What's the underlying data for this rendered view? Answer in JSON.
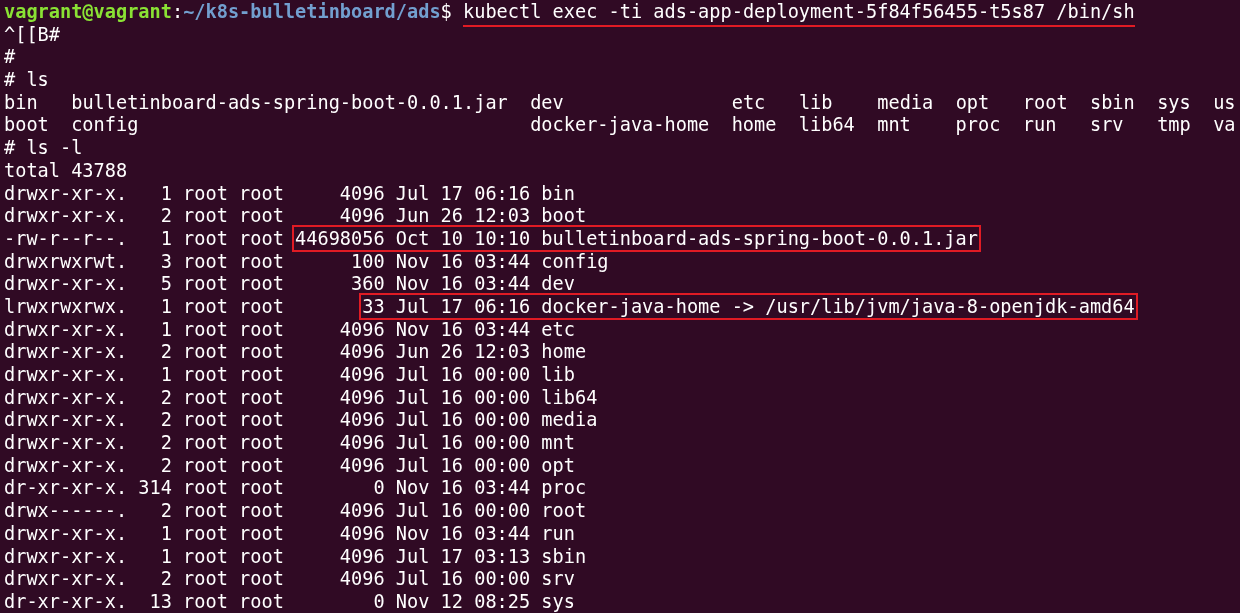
{
  "terminal": {
    "lines": [
      {
        "kind": "prompt",
        "user_host": "vagrant@vagrant",
        "separator": ":",
        "path": "~/k8s-bulletinboard/ads",
        "symbol": "$",
        "command": "kubectl exec -ti ads-app-deployment-5f84f56455-t5s87 /bin/sh",
        "underlined": true
      },
      {
        "kind": "text",
        "text": "^[[B#"
      },
      {
        "kind": "text",
        "text": "#"
      },
      {
        "kind": "text",
        "text": "# ls"
      },
      {
        "kind": "columns",
        "columns": [
          [
            "bin",
            "boot"
          ],
          [
            "bulletinboard-ads-spring-boot-0.0.1.jar",
            "config"
          ],
          [
            "dev",
            "docker-java-home"
          ],
          [
            "etc",
            "home"
          ],
          [
            "lib",
            "lib64"
          ],
          [
            "media",
            "mnt"
          ],
          [
            "opt",
            "proc"
          ],
          [
            "root",
            "run"
          ],
          [
            "sbin",
            "srv"
          ],
          [
            "sys",
            "tmp"
          ],
          [
            "us",
            "va"
          ]
        ]
      },
      {
        "kind": "text",
        "text": "# ls -l"
      },
      {
        "kind": "text",
        "text": "total 43788"
      },
      {
        "kind": "listing",
        "rows": [
          {
            "permissions": "drwxr-xr-x.",
            "links": "1",
            "owner": "root",
            "group": "root",
            "size": "4096",
            "date": "Jul 17 06:16",
            "name": "bin",
            "highlighted": false
          },
          {
            "permissions": "drwxr-xr-x.",
            "links": "2",
            "owner": "root",
            "group": "root",
            "size": "4096",
            "date": "Jun 26 12:03",
            "name": "boot",
            "highlighted": false
          },
          {
            "permissions": "-rw-r--r--.",
            "links": "1",
            "owner": "root",
            "group": "root",
            "size": "44698056",
            "date": "Oct 10 10:10",
            "name": "bulletinboard-ads-spring-boot-0.0.1.jar",
            "highlighted": true
          },
          {
            "permissions": "drwxrwxrwt.",
            "links": "3",
            "owner": "root",
            "group": "root",
            "size": "100",
            "date": "Nov 16 03:44",
            "name": "config",
            "highlighted": false
          },
          {
            "permissions": "drwxr-xr-x.",
            "links": "5",
            "owner": "root",
            "group": "root",
            "size": "360",
            "date": "Nov 16 03:44",
            "name": "dev",
            "highlighted": false
          },
          {
            "permissions": "lrwxrwxrwx.",
            "links": "1",
            "owner": "root",
            "group": "root",
            "size": "33",
            "date": "Jul 17 06:16",
            "name": "docker-java-home -> /usr/lib/jvm/java-8-openjdk-amd64",
            "highlighted": true
          },
          {
            "permissions": "drwxr-xr-x.",
            "links": "1",
            "owner": "root",
            "group": "root",
            "size": "4096",
            "date": "Nov 16 03:44",
            "name": "etc",
            "highlighted": false
          },
          {
            "permissions": "drwxr-xr-x.",
            "links": "2",
            "owner": "root",
            "group": "root",
            "size": "4096",
            "date": "Jun 26 12:03",
            "name": "home",
            "highlighted": false
          },
          {
            "permissions": "drwxr-xr-x.",
            "links": "1",
            "owner": "root",
            "group": "root",
            "size": "4096",
            "date": "Jul 16 00:00",
            "name": "lib",
            "highlighted": false
          },
          {
            "permissions": "drwxr-xr-x.",
            "links": "2",
            "owner": "root",
            "group": "root",
            "size": "4096",
            "date": "Jul 16 00:00",
            "name": "lib64",
            "highlighted": false
          },
          {
            "permissions": "drwxr-xr-x.",
            "links": "2",
            "owner": "root",
            "group": "root",
            "size": "4096",
            "date": "Jul 16 00:00",
            "name": "media",
            "highlighted": false
          },
          {
            "permissions": "drwxr-xr-x.",
            "links": "2",
            "owner": "root",
            "group": "root",
            "size": "4096",
            "date": "Jul 16 00:00",
            "name": "mnt",
            "highlighted": false
          },
          {
            "permissions": "drwxr-xr-x.",
            "links": "2",
            "owner": "root",
            "group": "root",
            "size": "4096",
            "date": "Jul 16 00:00",
            "name": "opt",
            "highlighted": false
          },
          {
            "permissions": "dr-xr-xr-x.",
            "links": "314",
            "owner": "root",
            "group": "root",
            "size": "0",
            "date": "Nov 16 03:44",
            "name": "proc",
            "highlighted": false
          },
          {
            "permissions": "drwx------.",
            "links": "2",
            "owner": "root",
            "group": "root",
            "size": "4096",
            "date": "Jul 16 00:00",
            "name": "root",
            "highlighted": false
          },
          {
            "permissions": "drwxr-xr-x.",
            "links": "1",
            "owner": "root",
            "group": "root",
            "size": "4096",
            "date": "Nov 16 03:44",
            "name": "run",
            "highlighted": false
          },
          {
            "permissions": "drwxr-xr-x.",
            "links": "1",
            "owner": "root",
            "group": "root",
            "size": "4096",
            "date": "Jul 17 03:13",
            "name": "sbin",
            "highlighted": false
          },
          {
            "permissions": "drwxr-xr-x.",
            "links": "2",
            "owner": "root",
            "group": "root",
            "size": "4096",
            "date": "Jul 16 00:00",
            "name": "srv",
            "highlighted": false
          },
          {
            "permissions": "dr-xr-xr-x.",
            "links": "13",
            "owner": "root",
            "group": "root",
            "size": "0",
            "date": "Nov 12 08:25",
            "name": "sys",
            "highlighted": false
          }
        ]
      }
    ]
  }
}
